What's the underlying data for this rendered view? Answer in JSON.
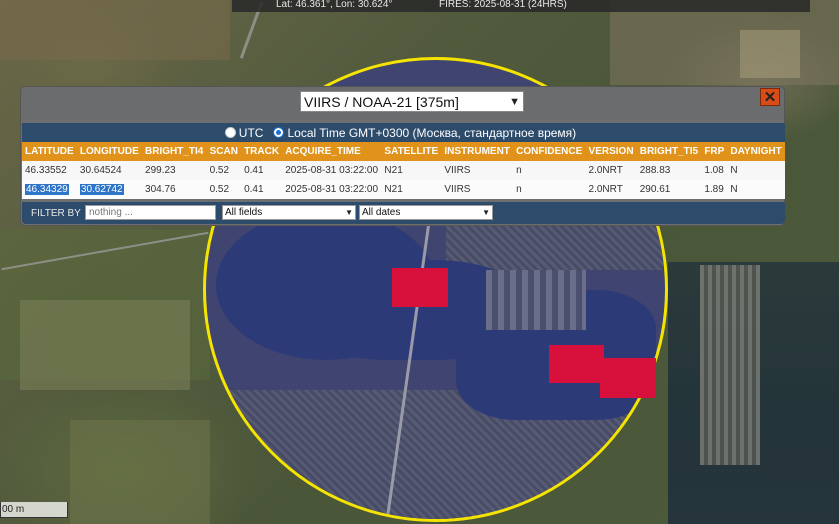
{
  "status_bar": {
    "coords": "Lat: 46.361°, Lon: 30.624°",
    "fires": "FIRES: 2025-08-31 (24HRS)"
  },
  "scale_bar": "00 m",
  "panel": {
    "satellite_select": "VIIRS / NOAA-21 [375m]",
    "close_label": "✕",
    "tz_utc": "UTC",
    "tz_local": "Local Time GMT+0300 (Москва, стандартное время)",
    "tz_selected": "local",
    "columns": [
      "LATITUDE",
      "LONGITUDE",
      "BRIGHT_TI4",
      "SCAN",
      "TRACK",
      "ACQUIRE_TIME",
      "SATELLITE",
      "INSTRUMENT",
      "CONFIDENCE",
      "VERSION",
      "BRIGHT_TI5",
      "FRP",
      "DAYNIGHT"
    ],
    "rows": [
      [
        "46.33552",
        "30.64524",
        "299.23",
        "0.52",
        "0.41",
        "2025-08-31 03:22:00",
        "N21",
        "VIIRS",
        "n",
        "2.0NRT",
        "288.83",
        "1.08",
        "N"
      ],
      [
        "46.34329",
        "30.62742",
        "304.76",
        "0.52",
        "0.41",
        "2025-08-31 03:22:00",
        "N21",
        "VIIRS",
        "n",
        "2.0NRT",
        "290.61",
        "1.89",
        "N"
      ]
    ],
    "filter_label": "FILTER BY",
    "filter_placeholder": "nothing ...",
    "field_select": "All fields",
    "date_select": "All dates"
  },
  "colors": {
    "circle": "#f5e400",
    "fire": "#d8103c",
    "header": "#e0921a",
    "bar": "#2d4b6a",
    "close": "#d94c17"
  }
}
